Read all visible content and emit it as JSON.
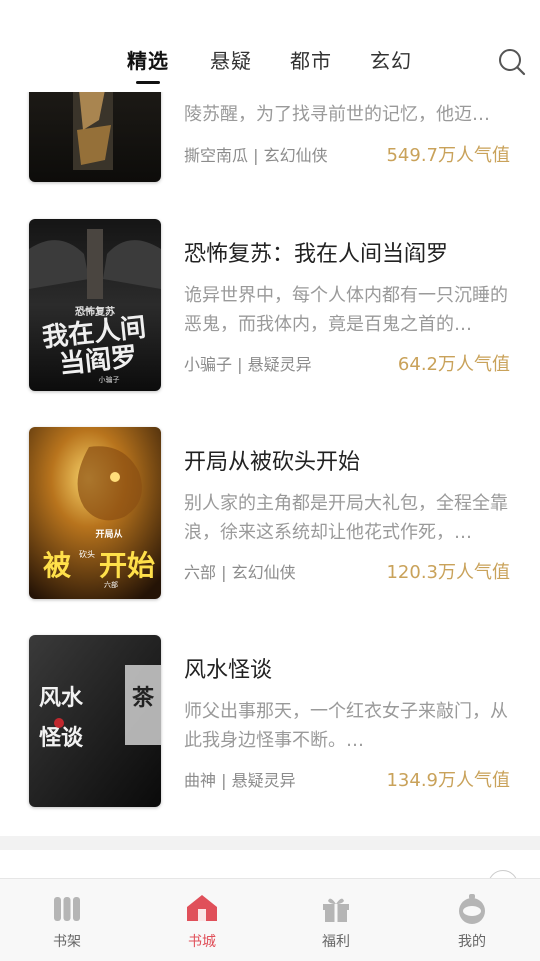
{
  "tabs": [
    {
      "label": "精选",
      "active": true
    },
    {
      "label": "悬疑",
      "active": false
    },
    {
      "label": "都市",
      "active": false
    },
    {
      "label": "玄幻",
      "active": false
    }
  ],
  "search_icon": "search-icon",
  "books": [
    {
      "title": "",
      "desc": "陵苏醒，为了找寻前世的记忆，他迈…",
      "meta": "撕空南瓜 | 玄幻仙侠",
      "popularity": "549.7万人气值"
    },
    {
      "title": "恐怖复苏：我在人间当阎罗",
      "desc": "诡异世界中，每个人体内都有一只沉睡的恶鬼，而我体内，竟是百鬼之首的…",
      "meta": "小骗子 | 悬疑灵异",
      "popularity": "64.2万人气值",
      "cover_text": [
        "我在人间",
        "当阎罗",
        "恐怖复苏",
        "小骗子"
      ]
    },
    {
      "title": "开局从被砍头开始",
      "desc": "别人家的主角都是开局大礼包，全程全靠浪，徐来这系统却让他花式作死，…",
      "meta": "六部 | 玄幻仙侠",
      "popularity": "120.3万人气值",
      "cover_text": [
        "开局从",
        "被",
        "砍头",
        "开始",
        "六部"
      ]
    },
    {
      "title": "风水怪谈",
      "desc": "师父出事那天，一个红衣女子来敲门，从此我身边怪事不断。…",
      "meta": "曲神 | 悬疑灵异",
      "popularity": "134.9万人气值",
      "cover_text": [
        "风水",
        "怪谈",
        "茶"
      ]
    }
  ],
  "bottom_nav": [
    {
      "label": "书架",
      "icon": "bookshelf-icon",
      "active": false
    },
    {
      "label": "书城",
      "icon": "bookstore-icon",
      "active": true
    },
    {
      "label": "福利",
      "icon": "gift-icon",
      "active": false
    },
    {
      "label": "我的",
      "icon": "profile-icon",
      "active": false
    }
  ],
  "colors": {
    "accent": "#e0505a",
    "popularity": "#c9a25a",
    "text_gray": "#9a9a9a"
  }
}
